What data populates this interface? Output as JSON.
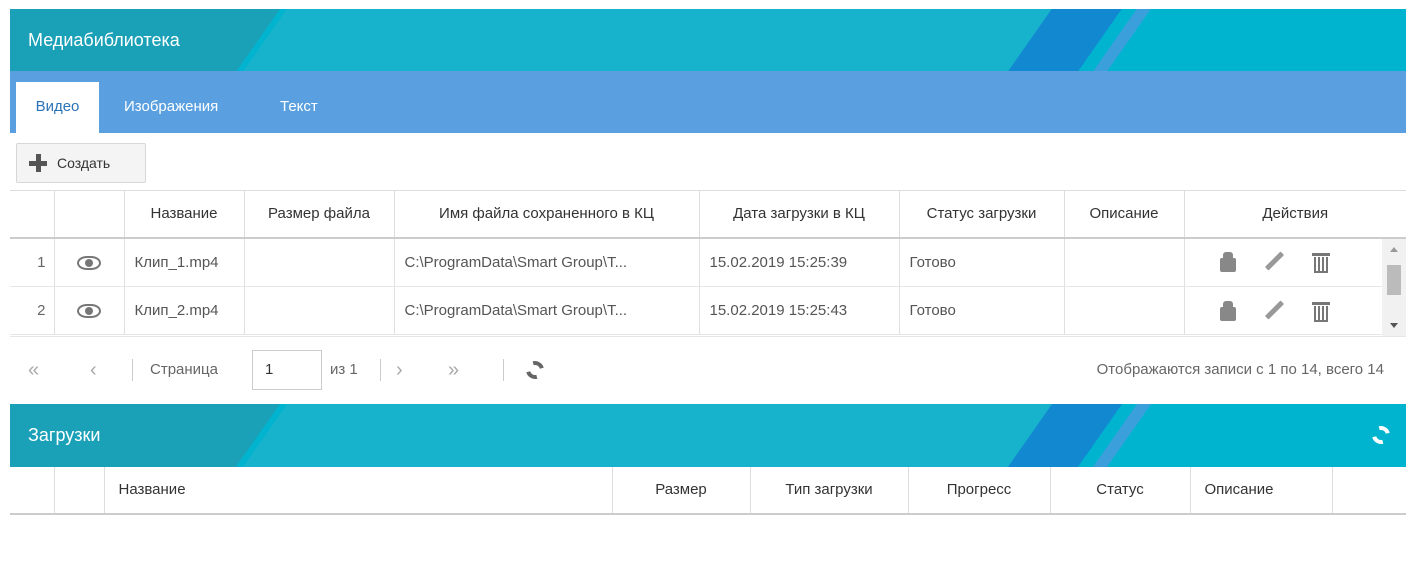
{
  "media_library": {
    "title": "Медиабиблиотека",
    "tabs": [
      {
        "label": "Видео",
        "active": true
      },
      {
        "label": "Изображения",
        "active": false
      },
      {
        "label": "Текст",
        "active": false
      }
    ],
    "create_label": "Создать",
    "columns": [
      "",
      "",
      "Название",
      "Размер файла",
      "Имя файла сохраненного в КЦ",
      "Дата загрузки в КЦ",
      "Статус загрузки",
      "Описание",
      "Действия"
    ],
    "rows": [
      {
        "num": "1",
        "name": "Клип_1.mp4",
        "size": "",
        "path": "C:\\ProgramData\\Smart Group\\T...",
        "date": "15.02.2019 15:25:39",
        "status": "Готово",
        "description": ""
      },
      {
        "num": "2",
        "name": "Клип_2.mp4",
        "size": "",
        "path": "C:\\ProgramData\\Smart Group\\T...",
        "date": "15.02.2019 15:25:43",
        "status": "Готово",
        "description": ""
      }
    ],
    "pager": {
      "first": "«",
      "prev": "‹",
      "page_label": "Страница",
      "page_value": "1",
      "of_label": "из 1",
      "next": "›",
      "last": "»",
      "info": "Отображаются записи с 1 по 14, всего 14"
    }
  },
  "downloads": {
    "title": "Загрузки",
    "columns": [
      "",
      "",
      "Название",
      "Размер",
      "Тип загрузки",
      "Прогресс",
      "Статус",
      "Описание",
      ""
    ]
  },
  "colors": {
    "banner": "#00b4d0",
    "tabbar": "#5aa0e0",
    "active_tab_text": "#2a73b8"
  },
  "icons": [
    "plus-icon",
    "eye-icon",
    "spy-icon",
    "pencil-icon",
    "trash-icon",
    "refresh-icon"
  ]
}
